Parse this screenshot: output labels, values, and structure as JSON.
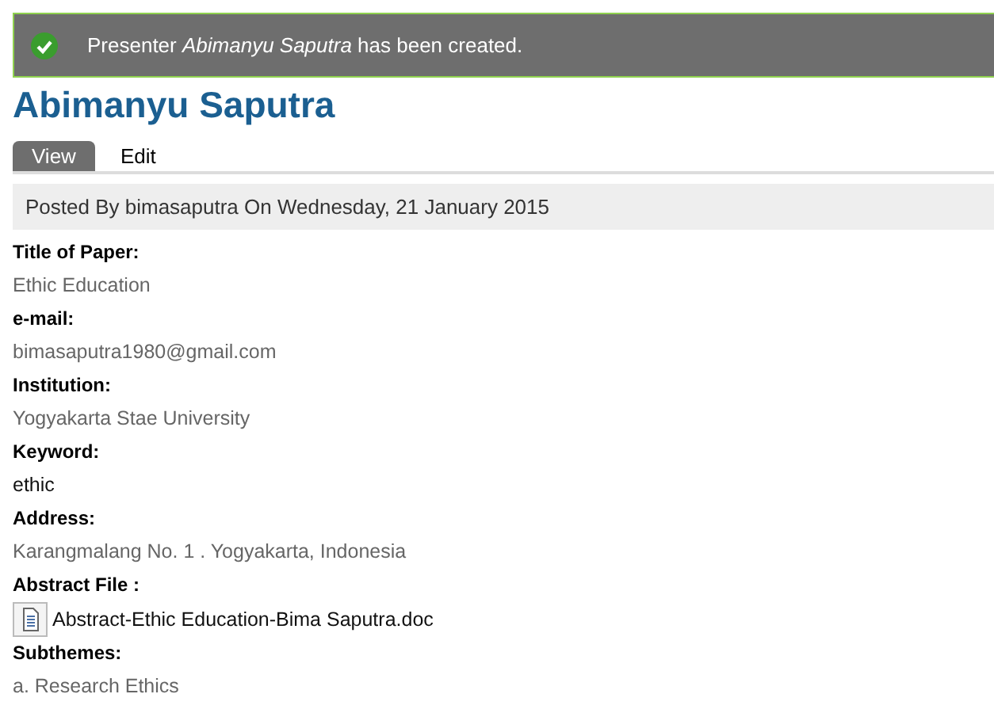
{
  "message": {
    "text": "Presenter *Abimanyu Saputra* has been created."
  },
  "title": "Abimanyu Saputra",
  "tabs": [
    {
      "label": "View",
      "selected": true
    },
    {
      "label": "Edit",
      "selected": false
    }
  ],
  "submitted": "Posted By bimasaputra On Wednesday, 21 January 2015",
  "fields": [
    {
      "label": "Title of Paper:",
      "kind": "text",
      "value": "Ethic Education"
    },
    {
      "label": "e-mail:",
      "kind": "text",
      "value": "bimasaputra1980@gmail.com"
    },
    {
      "label": "Institution:",
      "kind": "text",
      "value": "Yogyakarta Stae University"
    },
    {
      "label": "Keyword:",
      "kind": "term",
      "value": "ethic"
    },
    {
      "label": "Address:",
      "kind": "text",
      "value": "Karangmalang No. 1 . Yogyakarta, Indonesia"
    },
    {
      "label": "Abstract File :",
      "kind": "file",
      "value": "Abstract-Ethic Education-Bima Saputra.doc"
    },
    {
      "label": "Subthemes:",
      "kind": "text",
      "value": "a. Research Ethics"
    }
  ]
}
